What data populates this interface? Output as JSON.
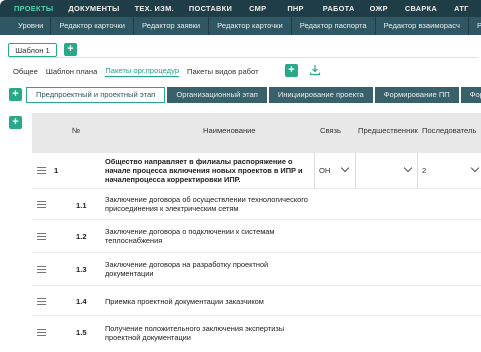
{
  "topnav": {
    "items": [
      "ПРОЕКТЫ",
      "ДОКУМЕНТЫ",
      "ТЕХ. ИЗМ.",
      "ПОСТАВКИ",
      "СМР",
      "ПНР",
      "РАБОТА",
      "ОЖР",
      "СВАРКА",
      "АТГ",
      "КС"
    ]
  },
  "subnav": {
    "items": [
      "Уровни",
      "Редактор карточки",
      "Редактор заявки",
      "Редактор карточки",
      "Редактор паспорта",
      "Редактор взаиморасч",
      "Роли в"
    ]
  },
  "template_tab": {
    "label": "Шаблон 1",
    "add": "+"
  },
  "tabs2": {
    "items": [
      "Общее",
      "Шаблон плана",
      "Пакеты орг.процедур",
      "Пакеты видов работ"
    ],
    "add": "+"
  },
  "stages": {
    "add": "+",
    "items": [
      "Предпроектный и проектный этап",
      "Организационный этап",
      "Инициирование проекта",
      "Формирование ПП",
      "Формиров"
    ]
  },
  "table": {
    "add": "+",
    "headers": {
      "num": "№",
      "name": "Наименование",
      "link": "Связь",
      "pred": "Предшественник",
      "succ": "Последователь"
    },
    "rows": [
      {
        "num": "1",
        "name": "Общество направляет в филиалы распоряжение о начале процесса включения новых проектов в ИПР и началепроцесса корректировки ИПР.",
        "link": "ОН",
        "succ": "2"
      },
      {
        "num": "1.1",
        "name": "Заключение договора об осуществлении технологического присоединения к электрическим сетям"
      },
      {
        "num": "1.2",
        "name": "Заключение договора о подключении к системам теплоснабжения"
      },
      {
        "num": "1.3",
        "name": "Заключение договора на разработку проектной документации"
      },
      {
        "num": "1.4",
        "name": "Приемка проектной документации заказчиком"
      },
      {
        "num": "1.5",
        "name": "Получение положительного заключения экспертизы проектной документации"
      }
    ]
  },
  "colors": {
    "accent": "#2aa98a",
    "nav": "#1f3d47",
    "subnav": "#2e5663"
  }
}
